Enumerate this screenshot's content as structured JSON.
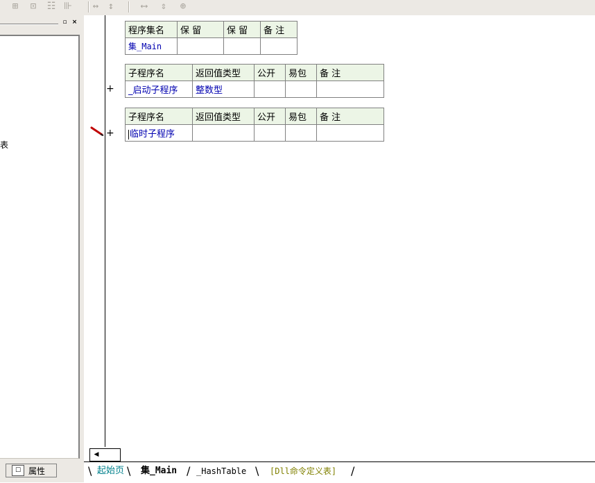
{
  "left_panel": {
    "clipped_char": "表",
    "property_tab_label": "属性"
  },
  "program_set_table": {
    "headers": [
      "程序集名",
      "保 留",
      "保 留",
      "备 注"
    ],
    "row": [
      "集_Main",
      "",
      "",
      ""
    ]
  },
  "sub_table_1": {
    "headers": [
      "子程序名",
      "返回值类型",
      "公开",
      "易包",
      "备 注"
    ],
    "row": [
      "_启动子程序",
      "整数型",
      "",
      "",
      ""
    ],
    "expand": "+"
  },
  "sub_table_2": {
    "headers": [
      "子程序名",
      "返回值类型",
      "公开",
      "易包",
      "备 注"
    ],
    "row": [
      "临时子程序",
      "",
      "",
      "",
      ""
    ],
    "expand": "+"
  },
  "tabs": [
    {
      "label": "起始页"
    },
    {
      "label": "集_Main"
    },
    {
      "label": "_HashTable"
    },
    {
      "label": "[Dll命令定义表]"
    }
  ],
  "colors": {
    "header_bg": "#ecf5e6",
    "link_blue": "#0000b0",
    "tab_teal": "#00808c",
    "tab_olive": "#808000",
    "pencil_red": "#c00000"
  }
}
